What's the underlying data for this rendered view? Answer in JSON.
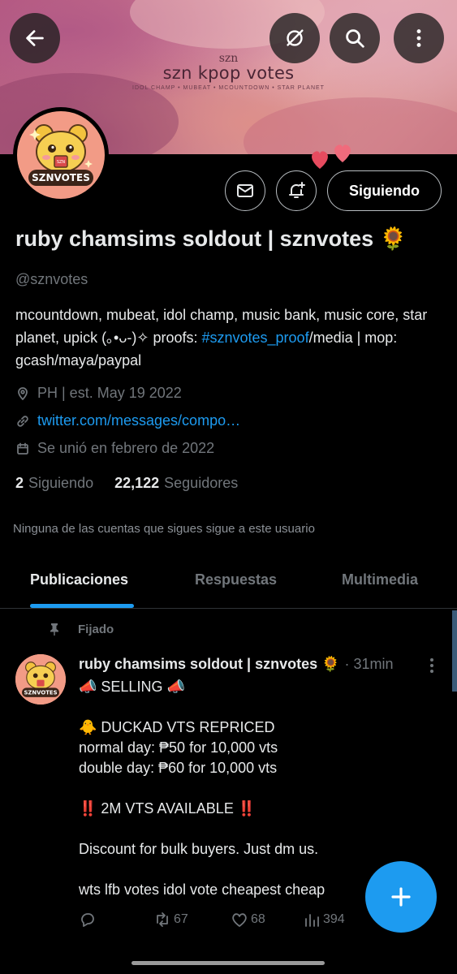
{
  "banner": {
    "mark": "szn",
    "title": "szn kpop votes",
    "subtitle": "IDOL CHAMP • MUBEAT • MCOUNTDOWN • STAR PLANET"
  },
  "toolbar": {
    "back_icon": "arrow-left-icon",
    "grok_icon": "grok-icon",
    "search_icon": "search-icon",
    "more_icon": "more-vertical-icon"
  },
  "avatar": {
    "badge_text": "SZNVOTES",
    "mini_label": "SZN"
  },
  "actions": {
    "message_icon": "envelope-icon",
    "notify_icon": "bell-plus-icon",
    "follow_label": "Siguiendo"
  },
  "profile": {
    "display_name": "ruby chamsims soldout | sznvotes 🌻",
    "handle": "@sznvotes",
    "bio_part1": "mcountdown, mubeat, idol champ, music bank, music core, star planet, upick (｡•ᴗ-)✧ proofs: ",
    "bio_link": "#sznvotes_proof",
    "bio_part2": "/media | mop: gcash/maya/paypal",
    "location": "PH | est. May 19 2022",
    "website": "twitter.com/messages/compo…",
    "joined": "Se unió en febrero de 2022"
  },
  "stats": {
    "following_count": "2",
    "following_label": "Siguiendo",
    "followers_count": "22,122",
    "followers_label": "Seguidores"
  },
  "followed_note": "Ninguna de las cuentas que sigues sigue a este usuario",
  "tabs": {
    "posts": "Publicaciones",
    "replies": "Respuestas",
    "media": "Multimedia"
  },
  "post": {
    "pinned_label": "Fijado",
    "author": "ruby chamsims soldout | sznvotes 🌻",
    "time": "· 31min",
    "lines": [
      "📣 SELLING 📣",
      "",
      "🐥 DUCKAD VTS REPRICED",
      "normal day: ₱50 for 10,000 vts",
      "double day: ₱60 for 10,000 vts",
      "",
      "‼️ 2M VTS AVAILABLE ‼️",
      "",
      "Discount for bulk buyers. Just dm us.",
      "",
      "wts lfb votes idol vote cheapest cheap"
    ],
    "retweets": "67",
    "likes": "68",
    "views": "394"
  },
  "colors": {
    "accent": "#1d9bf0",
    "background": "#000000",
    "muted": "#71767b"
  }
}
